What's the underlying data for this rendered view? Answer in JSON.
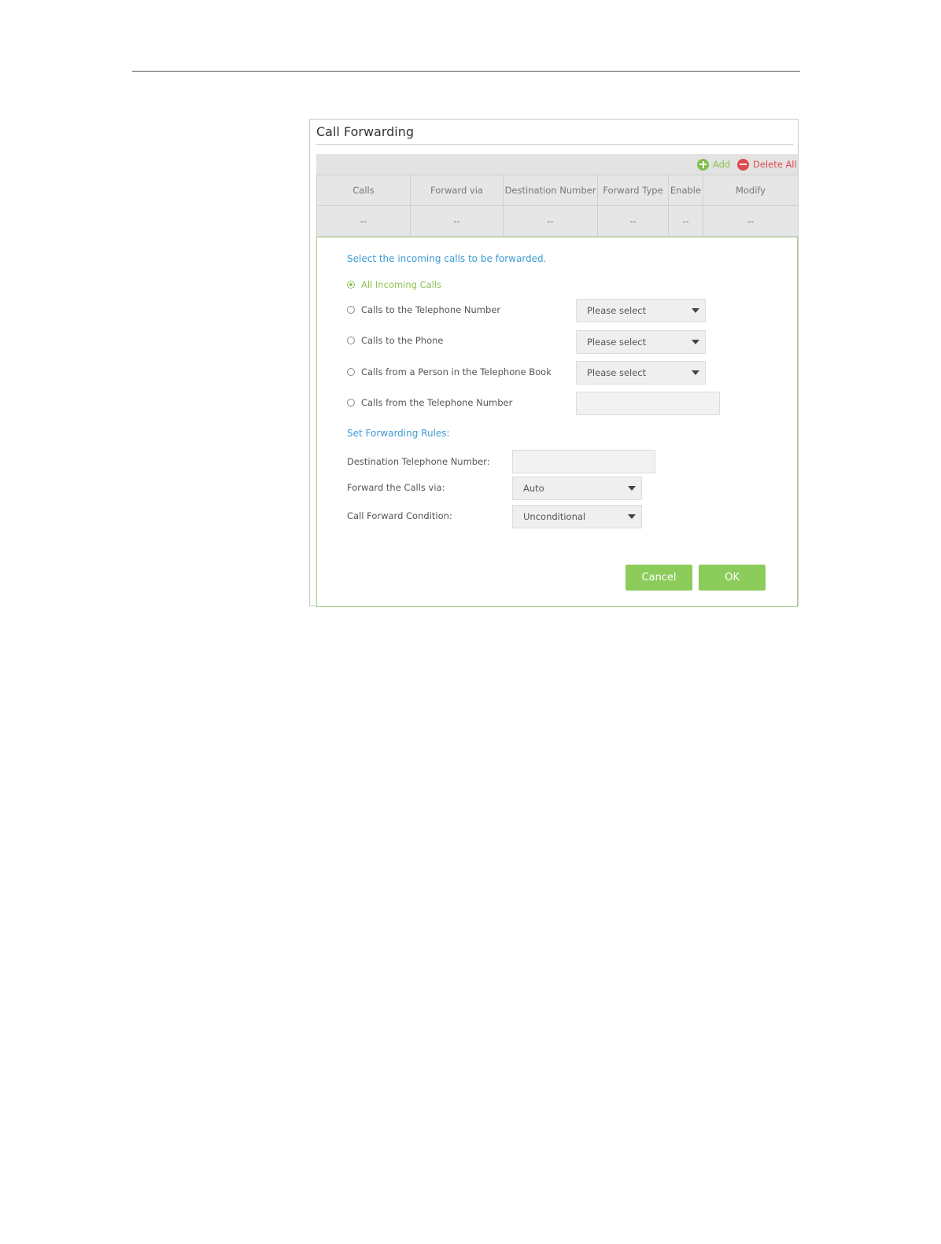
{
  "panel": {
    "title": "Call Forwarding"
  },
  "toolbar": {
    "add_label": "Add",
    "delete_all_label": "Delete All"
  },
  "table": {
    "columns": [
      "Calls",
      "Forward via",
      "Destination Number",
      "Forward Type",
      "Enable",
      "Modify"
    ],
    "rows": [
      [
        "--",
        "--",
        "--",
        "--",
        "--",
        "--"
      ]
    ]
  },
  "form": {
    "incoming_heading": "Select the incoming calls to be forwarded.",
    "options": [
      {
        "label": "All Incoming Calls",
        "selected": true
      },
      {
        "label": "Calls to the Telephone Number",
        "selected": false,
        "select_value": "Please select"
      },
      {
        "label": "Calls to the Phone",
        "selected": false,
        "select_value": "Please select"
      },
      {
        "label": "Calls from a Person in the Telephone Book",
        "selected": false,
        "select_value": "Please select"
      },
      {
        "label": "Calls from the Telephone Number",
        "selected": false,
        "input_value": ""
      }
    ],
    "rules_heading": "Set Forwarding Rules:",
    "destination_label": "Destination Telephone Number:",
    "destination_value": "",
    "forward_via_label": "Forward the Calls via:",
    "forward_via_value": "Auto",
    "condition_label": "Call Forward Condition:",
    "condition_value": "Unconditional"
  },
  "actions": {
    "cancel_label": "Cancel",
    "ok_label": "OK"
  },
  "colors": {
    "accent_green": "#8ccc5b",
    "link_blue": "#3b9bd4",
    "delete_red": "#e0494d"
  },
  "icons": [
    "add-icon",
    "delete-all-icon",
    "caret-down-icon"
  ]
}
